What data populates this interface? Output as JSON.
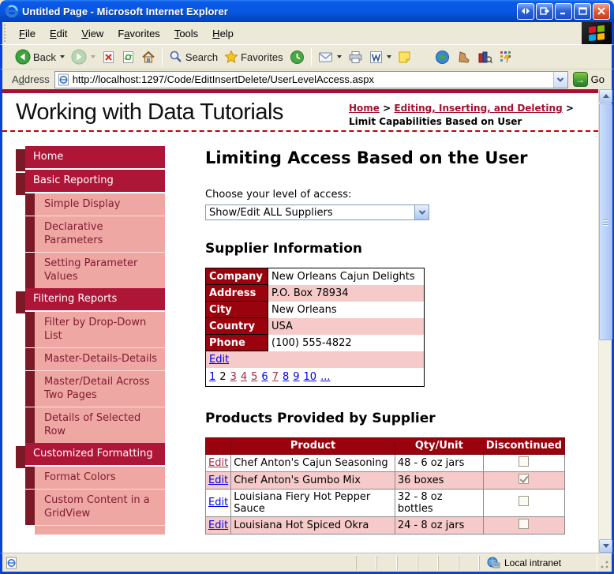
{
  "window": {
    "title": "Untitled Page - Microsoft Internet Explorer"
  },
  "menu": {
    "items": [
      {
        "pre": "",
        "key": "F",
        "post": "ile"
      },
      {
        "pre": "",
        "key": "E",
        "post": "dit"
      },
      {
        "pre": "",
        "key": "V",
        "post": "iew"
      },
      {
        "pre": "F",
        "key": "a",
        "post": "vorites"
      },
      {
        "pre": "",
        "key": "T",
        "post": "ools"
      },
      {
        "pre": "",
        "key": "H",
        "post": "elp"
      }
    ]
  },
  "toolbar": {
    "back_label": "Back",
    "search_label": "Search",
    "favorites_label": "Favorites"
  },
  "address_bar": {
    "label": {
      "pre": "A",
      "key": "d",
      "post": "dress"
    },
    "url": "http://localhost:1297/Code/EditInsertDelete/UserLevelAccess.aspx",
    "go_label": "Go"
  },
  "page": {
    "site_title": "Working with Data Tutorials",
    "breadcrumb": {
      "link1": "Home",
      "link2": "Editing, Inserting, and Deleting",
      "sep": ">",
      "current": "Limit Capabilities Based on User"
    },
    "sidebar": {
      "items": [
        {
          "label": "Home",
          "level": 1
        },
        {
          "label": "Basic Reporting",
          "level": 1
        },
        {
          "label": "Simple Display",
          "level": 2
        },
        {
          "label": "Declarative Parameters",
          "level": 2
        },
        {
          "label": "Setting Parameter Values",
          "level": 2
        },
        {
          "label": "Filtering Reports",
          "level": 1
        },
        {
          "label": "Filter by Drop-Down List",
          "level": 2
        },
        {
          "label": "Master-Details-Details",
          "level": 2
        },
        {
          "label": "Master/Detail Across Two Pages",
          "level": 2
        },
        {
          "label": "Details of Selected Row",
          "level": 2
        },
        {
          "label": "Customized Formatting",
          "level": 1
        },
        {
          "label": "Format Colors",
          "level": 2
        },
        {
          "label": "Custom Content in a GridView",
          "level": 2
        },
        {
          "label": "",
          "level": 2,
          "partial": true
        }
      ]
    },
    "main": {
      "heading": "Limiting Access Based on the User",
      "access_label": "Choose your level of access:",
      "access_value": "Show/Edit ALL Suppliers",
      "supplier": {
        "title": "Supplier Information",
        "fields": [
          {
            "label": "Company",
            "value": "New Orleans Cajun Delights"
          },
          {
            "label": "Address",
            "value": "P.O. Box 78934"
          },
          {
            "label": "City",
            "value": "New Orleans"
          },
          {
            "label": "Country",
            "value": "USA"
          },
          {
            "label": "Phone",
            "value": "(100) 555-4822"
          }
        ],
        "edit_label": "Edit",
        "pager": [
          {
            "text": "1",
            "state": "link"
          },
          {
            "text": "2",
            "state": "current"
          },
          {
            "text": "3",
            "state": "visited"
          },
          {
            "text": "4",
            "state": "visited"
          },
          {
            "text": "5",
            "state": "visited"
          },
          {
            "text": "6",
            "state": "link"
          },
          {
            "text": "7",
            "state": "visited"
          },
          {
            "text": "8",
            "state": "link"
          },
          {
            "text": "9",
            "state": "link"
          },
          {
            "text": "10",
            "state": "link"
          },
          {
            "text": "...",
            "state": "link"
          }
        ]
      },
      "products": {
        "title": "Products Provided by Supplier",
        "edit_label": "Edit",
        "columns": [
          "",
          "Product",
          "Qty/Unit",
          "Discontinued"
        ],
        "rows": [
          {
            "product": "Chef Anton's Cajun Seasoning",
            "qty": "48 - 6 oz jars",
            "discontinued": false,
            "edit_visited": true
          },
          {
            "product": "Chef Anton's Gumbo Mix",
            "qty": "36 boxes",
            "discontinued": true,
            "edit_visited": false
          },
          {
            "product": "Louisiana Fiery Hot Pepper Sauce",
            "qty": "32 - 8 oz bottles",
            "discontinued": false,
            "edit_visited": false
          },
          {
            "product": "Louisiana Hot Spiced Okra",
            "qty": "24 - 8 oz jars",
            "discontinued": false,
            "edit_visited": false
          }
        ]
      }
    }
  },
  "status_bar": {
    "zone": "Local intranet"
  },
  "colors": {
    "crimson": "#AE1638",
    "maroon_shadow": "#7B1A26",
    "sidebar_pink": "#EFA7A4",
    "table_header": "#9A030E",
    "row_pink": "#F7CACA",
    "link_blue": "#0000EE",
    "link_visited": "#A42A42",
    "xp_titlebar": "#0757E0",
    "chrome": "#ECE9D8"
  }
}
